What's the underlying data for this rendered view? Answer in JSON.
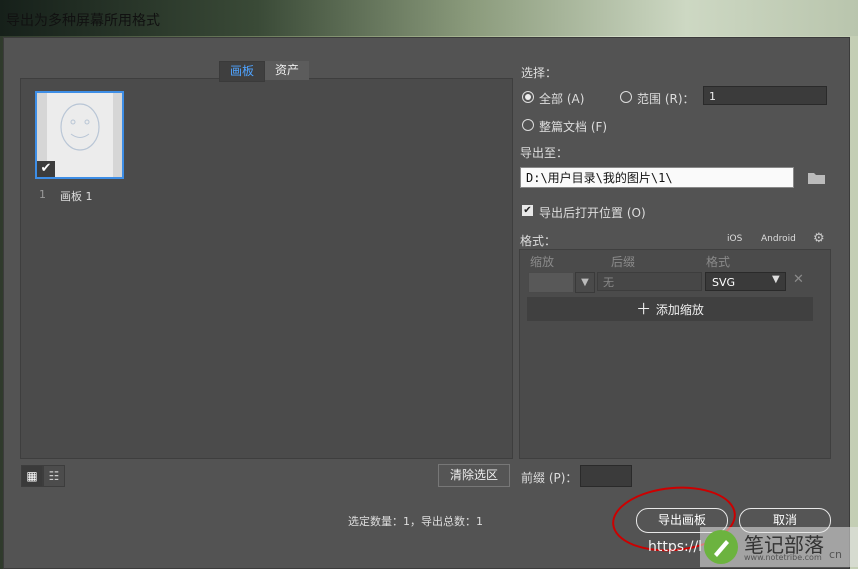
{
  "window": {
    "title": "导出为多种屏幕所用格式"
  },
  "tabs": [
    {
      "label": "画板",
      "active": true
    },
    {
      "label": "资产",
      "active": false
    }
  ],
  "artboards": [
    {
      "number": "1",
      "name": "画板 1",
      "checked": true
    }
  ],
  "left_footer": {
    "clear_selection": "清除选区",
    "summary": "选定数量：1，导出总数：1"
  },
  "select": {
    "label": "选择：",
    "all": "全部 (A)",
    "range": "范围 (R)：",
    "range_value": "1",
    "whole_document": "整篇文档 (F)",
    "selected": "all"
  },
  "export_to": {
    "label": "导出至：",
    "path": "D:\\用户目录\\我的图片\\1\\"
  },
  "open_after": {
    "label": "导出后打开位置 (O)",
    "checked": true
  },
  "formats": {
    "label": "格式：",
    "ios": "iOS",
    "android": "Android",
    "columns": [
      "缩放",
      "后缀",
      "格式"
    ],
    "row": {
      "scale": "",
      "suffix_placeholder": "无",
      "format": "SVG"
    },
    "add_scale": "添加缩放"
  },
  "prefix": {
    "label": "前缀 (P)：",
    "value": ""
  },
  "buttons": {
    "export": "导出画板",
    "cancel": "取消"
  },
  "overlay": {
    "url": "https://l"
  },
  "watermark": {
    "name": "笔记部落",
    "sub": "www.notetribe.com",
    "suffix": "cn"
  },
  "colors": {
    "accent": "#3e8ee6",
    "annotation": "#cc0000",
    "dialog_bg": "#535353"
  }
}
